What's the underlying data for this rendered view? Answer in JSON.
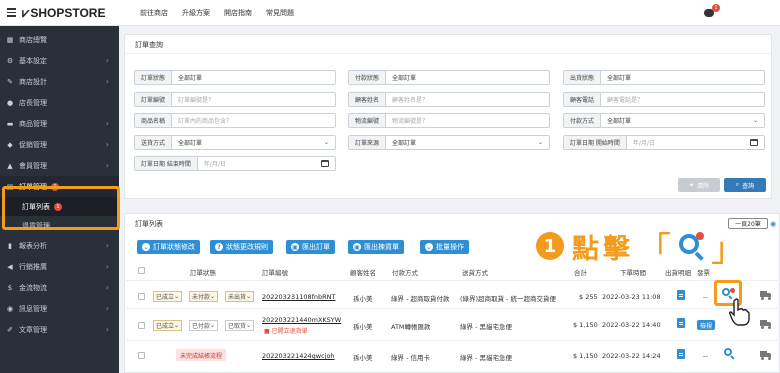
{
  "topbar": {
    "logo": "SHOPSTORE",
    "nav": [
      "前往商店",
      "升級方案",
      "開店指南",
      "常見問題"
    ],
    "notif_count": "1"
  },
  "sidebar": {
    "items": [
      {
        "label": "商店總覽",
        "icon": "dashboard-icon",
        "chevron": false
      },
      {
        "label": "基本設定",
        "icon": "gear-icon",
        "chevron": true
      },
      {
        "label": "商店設計",
        "icon": "wrench-icon",
        "chevron": true
      },
      {
        "label": "店長管理",
        "icon": "user-icon",
        "chevron": false
      },
      {
        "label": "商品管理",
        "icon": "cart-icon",
        "chevron": true
      },
      {
        "label": "促銷管理",
        "icon": "bell-icon",
        "chevron": true
      },
      {
        "label": "會員管理",
        "icon": "users-icon",
        "chevron": true
      }
    ],
    "order_mgmt": {
      "label": "訂單管理",
      "badge": "1"
    },
    "order_list": {
      "label": "訂單列表",
      "badge": "1"
    },
    "return_mgmt": "退貨管理",
    "items_after": [
      {
        "label": "報表分析",
        "icon": "chart-icon"
      },
      {
        "label": "行銷推廣",
        "icon": "megaphone-icon"
      },
      {
        "label": "金流物流",
        "icon": "money-icon"
      },
      {
        "label": "訊息管理",
        "icon": "message-icon"
      },
      {
        "label": "文章管理",
        "icon": "edit-icon"
      }
    ]
  },
  "query": {
    "title": "訂單查詢",
    "fields": [
      {
        "label": "訂單狀態",
        "value": "全部訂單",
        "dropdown": true
      },
      {
        "label": "付款狀態",
        "value": "全部訂單",
        "dropdown": true
      },
      {
        "label": "出貨狀態",
        "value": "全部訂單",
        "dropdown": true
      },
      {
        "label": "訂單編號",
        "placeholder": "訂單編號是？"
      },
      {
        "label": "顧客姓名",
        "placeholder": "顧客姓名是？"
      },
      {
        "label": "顧客電話",
        "placeholder": "顧客電話是？"
      },
      {
        "label": "商品名稱",
        "placeholder": "訂單內的商品包含？"
      },
      {
        "label": "物流編號",
        "placeholder": "物流編號是？"
      },
      {
        "label": "付款方式",
        "value": "全部訂單",
        "dropdown": true
      },
      {
        "label": "送貨方式",
        "value": "全部訂單",
        "dropdown": true
      },
      {
        "label": "訂單來源",
        "value": "全部訂單",
        "dropdown": true
      },
      {
        "label": "訂單日期 開始時間",
        "placeholder": "年/月/日",
        "calendar": true
      },
      {
        "label": "訂單日期 結束時間",
        "placeholder": "年/月/日",
        "calendar": true
      }
    ],
    "clear_label": "清除",
    "search_label": "查詢"
  },
  "list": {
    "title": "訂單列表",
    "per_page": "一頁20筆",
    "toolbar": [
      "訂單狀態修改",
      "狀態更改規則",
      "匯出訂單",
      "匯出揀貨單",
      "批量操作"
    ],
    "headers": [
      "訂單狀態",
      "訂單編號",
      "顧客姓名",
      "付款方式",
      "送貨方式",
      "合計",
      "下單時間",
      "出貨明細",
      "發票"
    ],
    "rows": [
      {
        "status": "已成立",
        "pay": "未付款",
        "ship": "未出貨",
        "order_no": "202203231108fnbRNT",
        "customer": "孫小美",
        "payment": "綠界 - 超商取貨付款",
        "shipping": "(綠界)超商取貨 - 統一超商交貨便",
        "total": "$ 255",
        "time": "2022-03-23 11:08",
        "invoice": "--"
      },
      {
        "status": "已成立",
        "pay": "已付款",
        "ship": "已取貨",
        "order_no": "202203221440mXKSYW",
        "warning": "已開立退貨單",
        "customer": "孫小美",
        "payment": "ATM轉帳匯款",
        "shipping": "綠界 - 黑貓宅急便",
        "total": "$ 1,150",
        "time": "2022-03-22 14:40",
        "invoice_tag": "檢視"
      },
      {
        "status_tag": "未完成結帳流程",
        "order_no": "202203221424qwcjoh",
        "customer": "孫小美",
        "payment": "綠界 - 信用卡",
        "shipping": "綠界 - 黑貓宅急便",
        "total": "$ 1,150",
        "time": "2022-03-22 14:24",
        "invoice": "--"
      }
    ]
  },
  "annotation": {
    "number": "1",
    "text": "點擊",
    "open_bracket": "「",
    "close_bracket": "」"
  },
  "colors": {
    "accent": "#f29b1d",
    "primary": "#2f8fd4",
    "sidebar": "#2a3038",
    "danger": "#e74c3c"
  }
}
